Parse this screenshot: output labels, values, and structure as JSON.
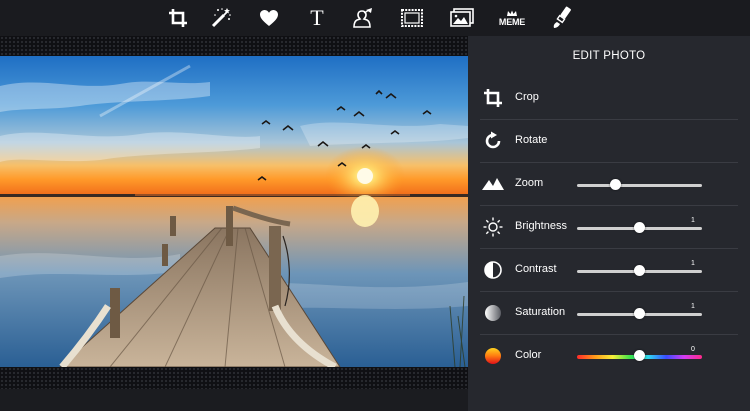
{
  "toolbar": {
    "tools": [
      {
        "icon": "crop-icon"
      },
      {
        "icon": "magic-wand-icon"
      },
      {
        "icon": "heart-icon"
      },
      {
        "icon": "text-icon",
        "label": "T"
      },
      {
        "icon": "sticker-icon"
      },
      {
        "icon": "frame-icon"
      },
      {
        "icon": "photo-frame-icon"
      },
      {
        "icon": "meme-icon",
        "label": "MEME"
      },
      {
        "icon": "brush-icon"
      }
    ]
  },
  "panel": {
    "title": "EDIT PHOTO",
    "items": [
      {
        "label": "Crop",
        "icon": "crop-icon"
      },
      {
        "label": "Rotate",
        "icon": "rotate-icon"
      },
      {
        "label": "Zoom",
        "icon": "mountains-icon",
        "level": 0.31
      },
      {
        "label": "Brightness",
        "icon": "sun-icon",
        "level": 0.5,
        "value": "1"
      },
      {
        "label": "Contrast",
        "icon": "contrast-icon",
        "level": 0.5,
        "value": "1"
      },
      {
        "label": "Saturation",
        "icon": "saturation-icon",
        "level": 0.5,
        "value": "1"
      },
      {
        "label": "Color",
        "icon": "color-icon",
        "level": 0.5,
        "value": "0"
      }
    ]
  },
  "colors": {
    "background": "#1b1c20",
    "panel": "#26282e",
    "divider": "#3a3c43",
    "slider_track": "#d0d0d0",
    "accent_sun": "#ffb020"
  }
}
